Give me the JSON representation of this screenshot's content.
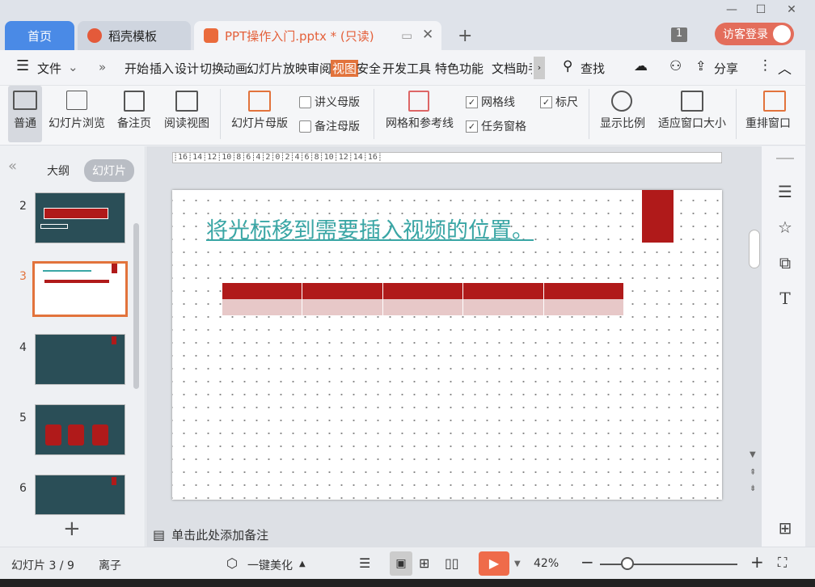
{
  "window": {
    "minimize": "—",
    "maximize": "☐",
    "close": "✕"
  },
  "tabs": [
    {
      "label": "首页",
      "icon": "home-tab"
    },
    {
      "label": "稻壳模板",
      "icon": "docer-icon"
    },
    {
      "label": "PPT操作入门.pptx * (只读)",
      "icon": "ppt-icon"
    }
  ],
  "titlebar": {
    "new_tab": "+",
    "badge": "1",
    "login": "访客登录"
  },
  "menu": {
    "file": "文件",
    "items": [
      "开始",
      "插入",
      "设计",
      "切换",
      "动画",
      "幻灯片放映",
      "审阅",
      "视图",
      "安全",
      "开发工具",
      "特色功能",
      "文档助手"
    ],
    "active": "视图",
    "search": "查找",
    "share": "分享"
  },
  "ribbon": {
    "normal": "普通",
    "slide_browse": "幻灯片浏览",
    "notes_page": "备注页",
    "reading_view": "阅读视图",
    "slide_master": "幻灯片母版",
    "handout_master": "讲义母版",
    "notes_master": "备注母版",
    "grid_guides": "网格和参考线",
    "gridlines": "网格线",
    "ruler": "标尺",
    "task_pane": "任务窗格",
    "zoom": "显示比例",
    "fit_window": "适应窗口大小",
    "rearrange": "重排窗口"
  },
  "left_panel": {
    "outline_tab": "大纲",
    "slides_tab": "幻灯片",
    "slides": [
      "2",
      "3",
      "4",
      "5",
      "6"
    ],
    "selected": "3",
    "add": "+"
  },
  "ruler": {
    "text": "┊16┊14┊12┊10┊8┊6┊4┊2┊0┊2┊4┊6┊8┊10┊12┊14┊16┊"
  },
  "slide": {
    "title": "将光标移到需要插入视频的位置。"
  },
  "notes": {
    "placeholder": "单击此处添加备注"
  },
  "status": {
    "slide_count": "幻灯片 3 / 9",
    "theme": "离子",
    "beautify": "一键美化",
    "zoom": "42%"
  },
  "colors": {
    "accent": "#e2733c",
    "slide_red": "#b01a1a",
    "title_teal": "#3aa6a5"
  }
}
